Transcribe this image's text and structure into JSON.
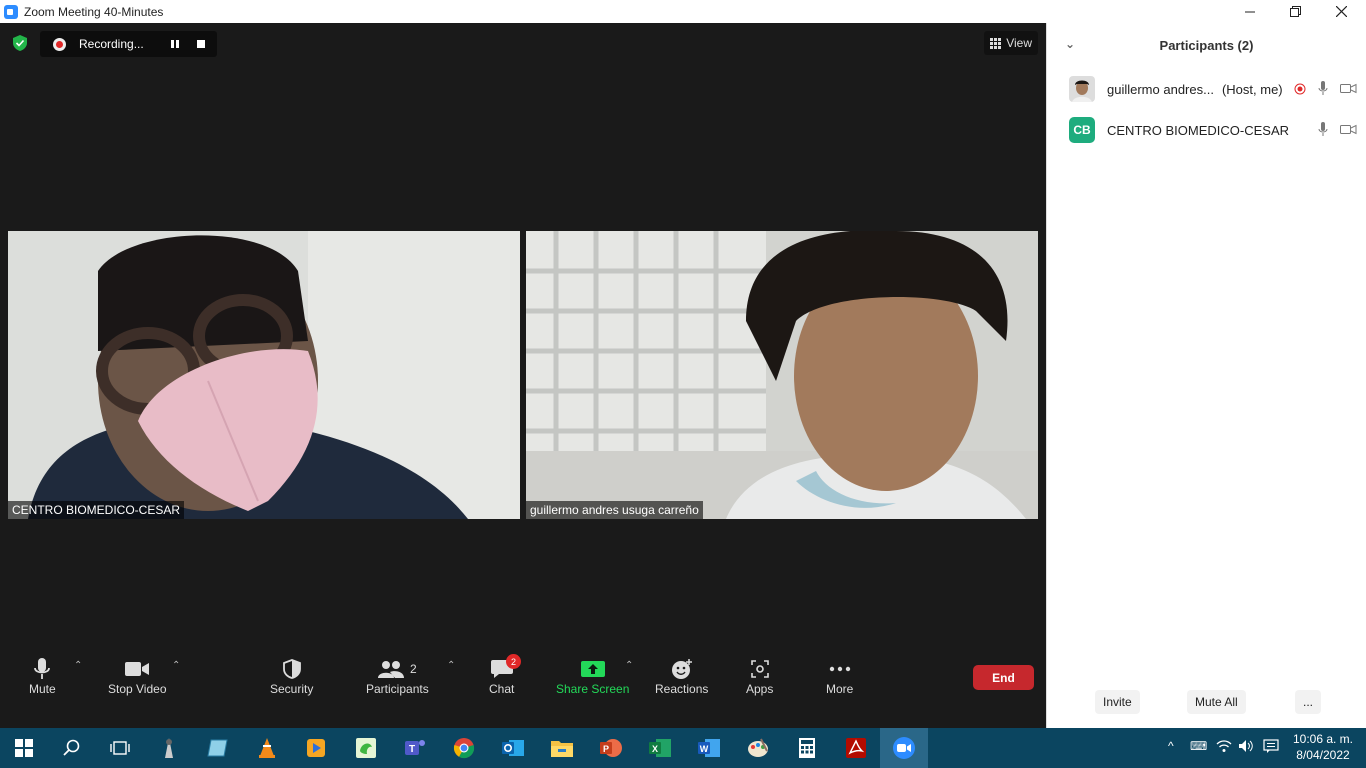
{
  "window": {
    "title": "Zoom Meeting 40-Minutes",
    "app_icon": "zoom-icon",
    "controls": [
      "minimize-icon",
      "restore-icon",
      "close-icon"
    ]
  },
  "meeting": {
    "recording_label": "Recording...",
    "view_label": "View",
    "tiles": [
      {
        "name": "CENTRO BIOMEDICO-CESAR"
      },
      {
        "name": "guillermo andres usuga carreño"
      }
    ]
  },
  "toolbar": {
    "mute": "Mute",
    "stop_video": "Stop Video",
    "security": "Security",
    "participants": "Participants",
    "participants_count": "2",
    "chat": "Chat",
    "chat_badge": "2",
    "share_screen": "Share Screen",
    "reactions": "Reactions",
    "apps": "Apps",
    "more": "More",
    "end": "End",
    "share_color": "#23d959",
    "end_color": "#c6282d"
  },
  "panel": {
    "title": "Participants (2)",
    "participants": [
      {
        "name": "guillermo andres...",
        "tag": "(Host, me)",
        "recording": true
      },
      {
        "name": "CENTRO BIOMEDICO-CESAR",
        "initials": "CB",
        "avatar_color": "#1eac7e"
      }
    ],
    "invite": "Invite",
    "mute_all": "Mute All",
    "more": "..."
  },
  "taskbar": {
    "clock_time": "10:06 a. m.",
    "clock_date": "8/04/2022",
    "apps": [
      "windows-start-icon",
      "search-icon",
      "task-view-icon",
      "app-icon",
      "app-icon",
      "vlc-icon",
      "media-player-icon",
      "app-icon",
      "teams-icon",
      "chrome-icon",
      "outlook-icon",
      "file-explorer-icon",
      "powerpoint-icon",
      "excel-icon",
      "word-icon",
      "paint-icon",
      "calculator-icon",
      "acrobat-icon",
      "zoom-icon"
    ]
  }
}
